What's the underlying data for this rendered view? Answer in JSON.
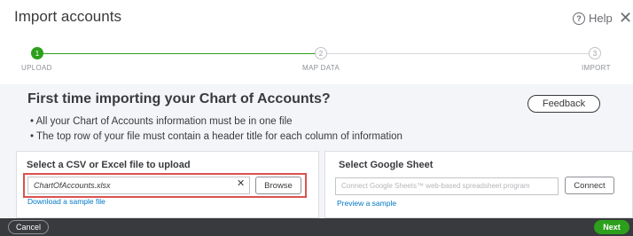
{
  "header": {
    "title": "Import accounts",
    "help_label": "Help",
    "help_icon_glyph": "?",
    "close_glyph": "✕"
  },
  "stepper": {
    "steps": [
      {
        "number": "1",
        "label": "UPLOAD",
        "state": "active"
      },
      {
        "number": "2",
        "label": "MAP DATA",
        "state": "inactive"
      },
      {
        "number": "3",
        "label": "IMPORT",
        "state": "inactive"
      }
    ]
  },
  "intro": {
    "heading": "First time importing your Chart of Accounts?",
    "bullets": [
      "All your Chart of Accounts information must be in one file",
      "The top row of your file must contain a header title for each column of information"
    ],
    "feedback_label": "Feedback"
  },
  "upload_card": {
    "title": "Select a CSV or Excel file to upload",
    "file_value": "ChartOfAccounts.xlsx",
    "clear_glyph": "✕",
    "browse_label": "Browse",
    "sample_link": "Download a sample file"
  },
  "google_card": {
    "title": "Select Google Sheet",
    "placeholder": "Connect Google Sheets™ web-based spreadsheet program",
    "connect_label": "Connect",
    "preview_link": "Preview a sample"
  },
  "footer": {
    "cancel_label": "Cancel",
    "next_label": "Next"
  },
  "colors": {
    "accent_green": "#2ca01c",
    "footer_dark": "#393a3d",
    "link_blue": "#0077c5",
    "highlight_red": "#d9534f"
  }
}
